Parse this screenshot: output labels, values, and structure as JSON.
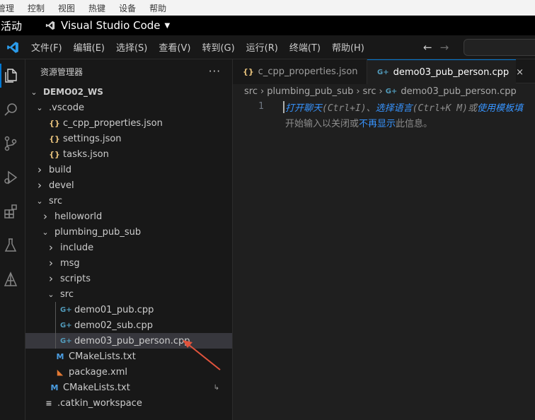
{
  "host_menu": [
    "管理",
    "控制",
    "视图",
    "热键",
    "设备",
    "帮助"
  ],
  "topbar": {
    "activities": "活动",
    "app_name": "Visual Studio Code"
  },
  "menubar": {
    "items": [
      "文件(F)",
      "编辑(E)",
      "选择(S)",
      "查看(V)",
      "转到(G)",
      "运行(R)",
      "终端(T)",
      "帮助(H)"
    ],
    "back_icon": "arrow-left-icon",
    "forward_icon": "arrow-right-icon"
  },
  "activity_bar": [
    "explorer-icon",
    "search-icon",
    "source-control-icon",
    "run-debug-icon",
    "extensions-icon",
    "testing-icon",
    "ros-icon"
  ],
  "explorer": {
    "title": "资源管理器",
    "more": "···",
    "workspace": "DEMO02_WS",
    "rows": [
      {
        "label": "DEMO02_WS",
        "depth": 0,
        "chev": "⌄",
        "icon": "",
        "bold": true
      },
      {
        "label": ".vscode",
        "depth": 1,
        "chev": "⌄",
        "icon": ""
      },
      {
        "label": "c_cpp_properties.json",
        "depth": 2,
        "chev": "",
        "icon": "{}"
      },
      {
        "label": "settings.json",
        "depth": 2,
        "chev": "",
        "icon": "{}"
      },
      {
        "label": "tasks.json",
        "depth": 2,
        "chev": "",
        "icon": "{}"
      },
      {
        "label": "build",
        "depth": 1,
        "chev": "›",
        "icon": ""
      },
      {
        "label": "devel",
        "depth": 1,
        "chev": "›",
        "icon": ""
      },
      {
        "label": "src",
        "depth": 1,
        "chev": "⌄",
        "icon": ""
      },
      {
        "label": "helloworld",
        "depth": 2,
        "chev": "›",
        "icon": ""
      },
      {
        "label": "plumbing_pub_sub",
        "depth": 2,
        "chev": "⌄",
        "icon": ""
      },
      {
        "label": "include",
        "depth": 3,
        "chev": "›",
        "icon": ""
      },
      {
        "label": "msg",
        "depth": 3,
        "chev": "›",
        "icon": ""
      },
      {
        "label": "scripts",
        "depth": 3,
        "chev": "›",
        "icon": ""
      },
      {
        "label": "src",
        "depth": 3,
        "chev": "⌄",
        "icon": ""
      },
      {
        "label": "demo01_pub.cpp",
        "depth": 4,
        "chev": "",
        "icon": "G+"
      },
      {
        "label": "demo02_sub.cpp",
        "depth": 4,
        "chev": "",
        "icon": "G+"
      },
      {
        "label": "demo03_pub_person.cpp",
        "depth": 4,
        "chev": "",
        "icon": "G+",
        "selected": true
      },
      {
        "label": "CMakeLists.txt",
        "depth": 3,
        "chev": "",
        "icon": "M"
      },
      {
        "label": "package.xml",
        "depth": 3,
        "chev": "",
        "icon": "rss"
      },
      {
        "label": "CMakeLists.txt",
        "depth": 2,
        "chev": "",
        "icon": "M",
        "badge": "↳"
      },
      {
        "label": ".catkin_workspace",
        "depth": 1,
        "chev": "",
        "icon": "≡"
      }
    ]
  },
  "tabs": [
    {
      "label": "c_cpp_properties.json",
      "icon": "{}",
      "active": false
    },
    {
      "label": "demo03_pub_person.cpp",
      "icon": "G+",
      "active": true,
      "close": "×"
    }
  ],
  "breadcrumb": [
    "src",
    "plumbing_pub_sub",
    "src",
    "demo03_pub_person.cpp"
  ],
  "editor": {
    "line_number": "1",
    "hint_line1": {
      "link1": "打开聊天",
      "key1": "(Ctrl+I)",
      "sep": "、",
      "link2": "选择语言",
      "key2": "(Ctrl+K M)",
      "or": "或",
      "link3": "使用模板填"
    },
    "hint_line2": {
      "pre": "开始输入以关闭或",
      "link": "不再显示",
      "post": "此信息。"
    }
  },
  "colors": {
    "accent": "#0078d4",
    "link": "#3794ff",
    "arrow": "#e0533c"
  }
}
